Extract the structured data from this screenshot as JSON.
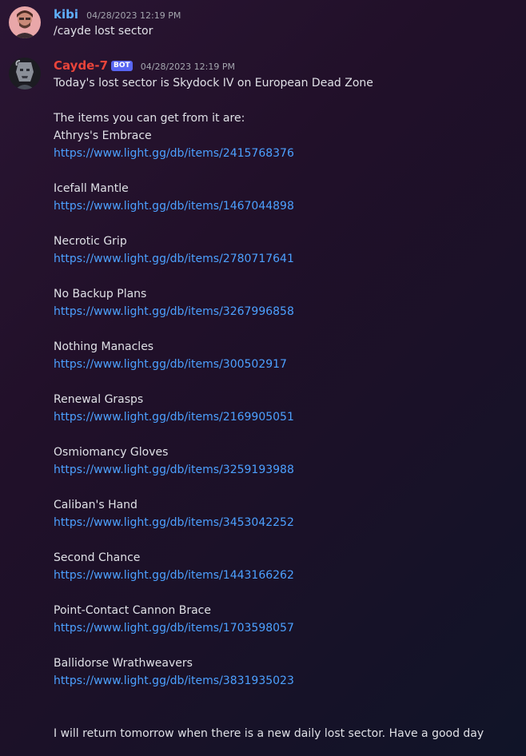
{
  "messages": [
    {
      "username": "kibi",
      "username_color": "#5fb0ff",
      "timestamp": "04/28/2023 12:19 PM",
      "text": "/cayde lost sector"
    },
    {
      "username": "Cayde-7",
      "username_color": "#e8443a",
      "badge": "BOT",
      "timestamp": "04/28/2023 12:19 PM",
      "intro": "Today's lost sector is Skydock IV on European Dead Zone",
      "items_heading": "The items you can get from it are:",
      "items": [
        {
          "name": "Athrys's Embrace",
          "url": "https://www.light.gg/db/items/2415768376"
        },
        {
          "name": "Icefall Mantle",
          "url": "https://www.light.gg/db/items/1467044898"
        },
        {
          "name": "Necrotic Grip",
          "url": "https://www.light.gg/db/items/2780717641"
        },
        {
          "name": "No Backup Plans",
          "url": "https://www.light.gg/db/items/3267996858"
        },
        {
          "name": "Nothing Manacles",
          "url": "https://www.light.gg/db/items/300502917"
        },
        {
          "name": "Renewal Grasps",
          "url": "https://www.light.gg/db/items/2169905051"
        },
        {
          "name": "Osmiomancy Gloves",
          "url": "https://www.light.gg/db/items/3259193988"
        },
        {
          "name": "Caliban's Hand",
          "url": "https://www.light.gg/db/items/3453042252"
        },
        {
          "name": "Second Chance",
          "url": "https://www.light.gg/db/items/1443166262"
        },
        {
          "name": "Point-Contact Cannon Brace",
          "url": "https://www.light.gg/db/items/1703598057"
        },
        {
          "name": "Ballidorse Wrathweavers",
          "url": "https://www.light.gg/db/items/3831935023"
        }
      ],
      "outro": "I will return tomorrow when there is a new daily lost sector. Have a good day"
    }
  ],
  "colors": {
    "link": "#4ca0ff",
    "bot_badge": "#5865f2"
  }
}
